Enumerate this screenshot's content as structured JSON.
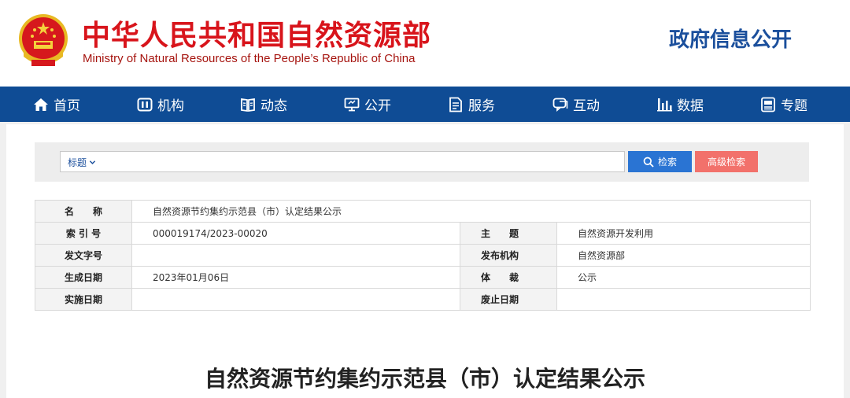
{
  "header": {
    "title": "中华人民共和国自然资源部",
    "subtitle": "Ministry of Natural Resources of the People’s Republic of China",
    "gov_info": "政府信息公开"
  },
  "nav": {
    "items": [
      {
        "label": "首页",
        "icon": "home-icon"
      },
      {
        "label": "机构",
        "icon": "organization-icon"
      },
      {
        "label": "动态",
        "icon": "book-icon"
      },
      {
        "label": "公开",
        "icon": "monitor-icon"
      },
      {
        "label": "服务",
        "icon": "document-icon"
      },
      {
        "label": "互动",
        "icon": "chat-icon"
      },
      {
        "label": "数据",
        "icon": "bar-chart-icon"
      },
      {
        "label": "专题",
        "icon": "topic-icon"
      }
    ]
  },
  "search": {
    "type_label": "标题",
    "placeholder": "",
    "search_label": "检索",
    "advanced_label": "高级检索"
  },
  "info": {
    "name_label": "名　　称",
    "name_value": "自然资源节约集约示范县（市）认定结果公示",
    "index_label": "索 引 号",
    "index_value": "000019174/2023-00020",
    "topic_label": "主　　题",
    "topic_value": "自然资源开发利用",
    "doc_no_label": "发文字号",
    "doc_no_value": "",
    "publisher_label": "发布机构",
    "publisher_value": "自然资源部",
    "date_label": "生成日期",
    "date_value": "2023年01月06日",
    "genre_label": "体　　裁",
    "genre_value": "公示",
    "effective_label": "实施日期",
    "effective_value": "",
    "expire_label": "废止日期",
    "expire_value": ""
  },
  "article": {
    "title": "自然资源节约集约示范县（市）认定结果公示"
  },
  "colors": {
    "brand_red": "#d8141b",
    "nav_blue": "#0f4c95",
    "search_blue": "#2a74d3",
    "advanced_red": "#f2716b"
  }
}
